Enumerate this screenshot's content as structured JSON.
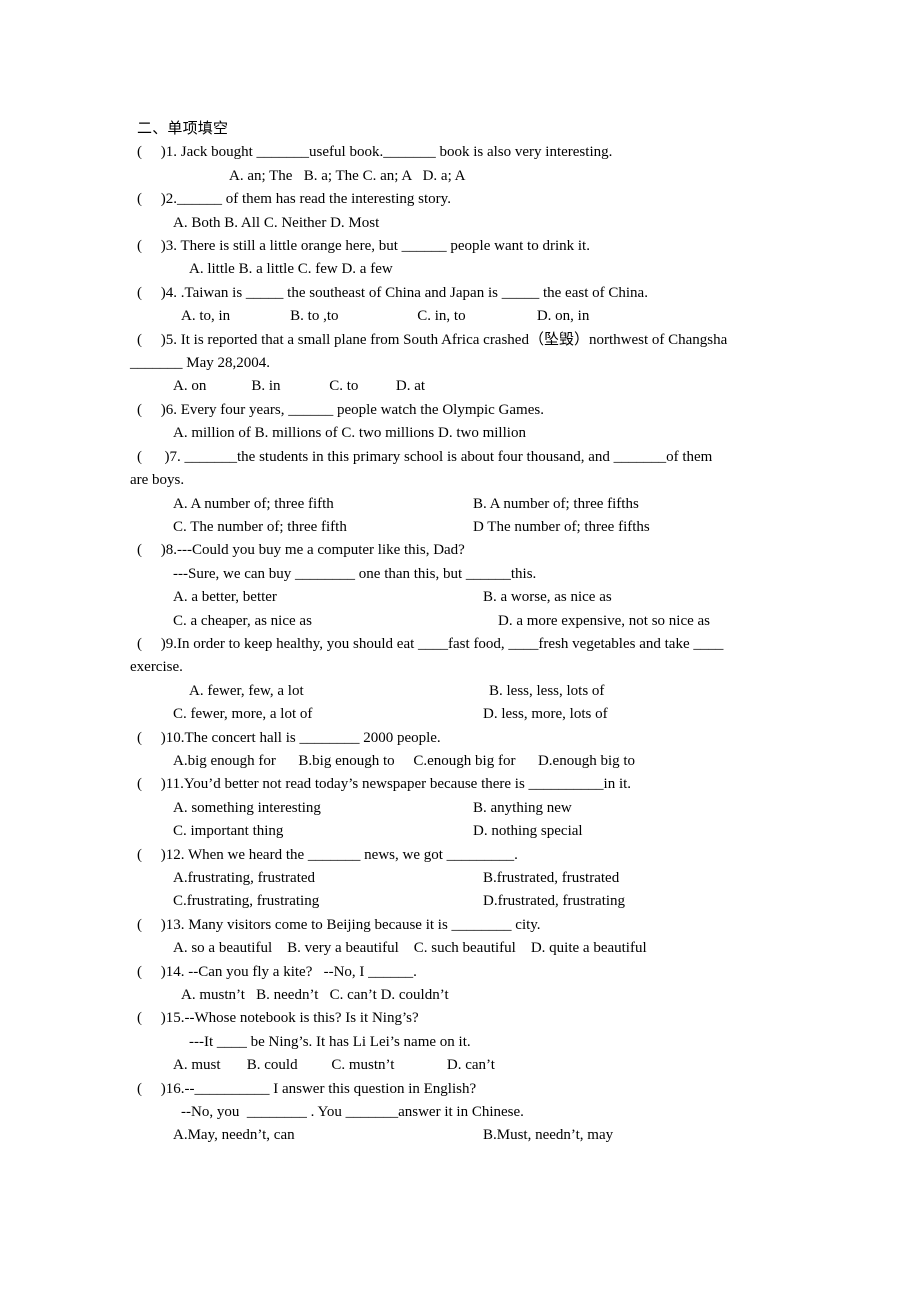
{
  "document": {
    "section_heading": "二、单项填空",
    "bracket": "(      )"
  },
  "questions": [
    {
      "id": 1,
      "stem": "(     )1. Jack bought _______useful book._______ book is also very interesting.",
      "options_lines": [
        "A. an; The   B. a; The C. an; A   D. a; A"
      ]
    },
    {
      "id": 2,
      "stem": "(     )2.______ of them has read the interesting story.",
      "options_lines": [
        "A. Both B. All C. Neither D. Most"
      ]
    },
    {
      "id": 3,
      "stem": "(     )3. There is still a little orange here, but ______ people want to drink it.",
      "options_lines": [
        "A. little B. a little C. few D. a few"
      ]
    },
    {
      "id": 4,
      "stem": "(     )4. .Taiwan is _____ the southeast of China and Japan is _____ the east of China.",
      "options_lines": [
        "A. to, in                B. to ,to                     C. in, to                   D. on, in"
      ]
    },
    {
      "id": 5,
      "stem_line1": "(     )5. It is reported that a small plane from South Africa crashed（坠毁）northwest of Changsha",
      "stem_line2": "_______ May 28,2004.",
      "options_lines": [
        "A. on            B. in             C. to          D. at"
      ]
    },
    {
      "id": 6,
      "stem": "(     )6. Every four years, ______ people watch the Olympic Games.",
      "options_lines": [
        "A. million of B. millions of C. two millions D. two million"
      ]
    },
    {
      "id": 7,
      "stem_line1": "(      )7. _______the students in this primary school is about four thousand, and _______of them",
      "stem_line2": "are boys.",
      "options_pairs": [
        {
          "left": "A. A number of; three fifth",
          "right": "B. A number of; three fifths"
        },
        {
          "left": "C. The number of; three fifth",
          "right": "D The number of; three fifths"
        }
      ]
    },
    {
      "id": 8,
      "stem_line1": "(     )8.---Could you buy me a computer like this, Dad?",
      "stem_line2": "---Sure, we can buy ________ one than this, but ______this.",
      "options_pairs": [
        {
          "left": "A. a better, better",
          "right": "B. a worse, as nice as"
        },
        {
          "left": "C. a cheaper, as nice as",
          "right": "D. a more expensive, not so nice as"
        }
      ]
    },
    {
      "id": 9,
      "stem_line1": "(     )9.In order to keep healthy, you should eat ____fast food, ____fresh vegetables and take ____",
      "stem_line2": "exercise.",
      "options_pairs": [
        {
          "left": "A. fewer, few, a lot",
          "right": "B. less, less, lots of"
        },
        {
          "left": "C. fewer, more, a lot of",
          "right": "D. less, more, lots of"
        }
      ]
    },
    {
      "id": 10,
      "stem": "(     )10.The concert hall is ________ 2000 people.",
      "options_lines": [
        "A.big enough for      B.big enough to     C.enough big for      D.enough big to"
      ]
    },
    {
      "id": 11,
      "stem": "(     )11.You’d better not read today’s newspaper because there is __________in it.",
      "options_pairs": [
        {
          "left": "A. something interesting",
          "right": "B. anything new"
        },
        {
          "left": "C. important thing",
          "right": "D. nothing special"
        }
      ]
    },
    {
      "id": 12,
      "stem": "(     )12. When we heard the _______ news, we got _________.",
      "options_pairs": [
        {
          "left": "A.frustrating, frustrated",
          "right": "B.frustrated, frustrated"
        },
        {
          "left": "C.frustrating, frustrating",
          "right": "D.frustrated, frustrating"
        }
      ]
    },
    {
      "id": 13,
      "stem": "(     )13. Many visitors come to Beijing because it is ________ city.",
      "options_lines": [
        "A. so a beautiful    B. very a beautiful    C. such beautiful    D. quite a beautiful"
      ]
    },
    {
      "id": 14,
      "stem": "(     )14. --Can you fly a kite?   --No, I ______.",
      "options_lines": [
        "A. mustn’t   B. needn’t   C. can’t D. couldn’t"
      ]
    },
    {
      "id": 15,
      "stem_line1": "(     )15.--Whose notebook is this? Is it Ning’s?",
      "stem_line2": "---It ____ be Ning’s. It has Li Lei’s name on it.",
      "options_lines": [
        "A. must       B. could         C. mustn’t              D. can’t"
      ]
    },
    {
      "id": 16,
      "stem_line1": "(     )16.--__________ I answer this question in English?",
      "stem_line2": "--No, you  ________ . You _______answer it in Chinese.",
      "options_pairs": [
        {
          "left": "A.May, needn’t, can",
          "right": "B.Must, needn’t, may"
        }
      ]
    }
  ]
}
